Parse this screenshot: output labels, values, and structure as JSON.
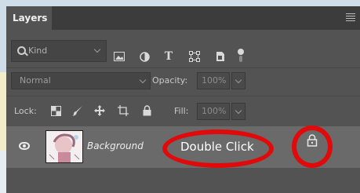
{
  "panel": {
    "title": "Layers"
  },
  "filter": {
    "kind_label": "Kind"
  },
  "blend": {
    "mode": "Normal",
    "opacity_label": "Opacity:",
    "opacity_value": "100%",
    "fill_label": "Fill:",
    "fill_value": "100%"
  },
  "lock": {
    "label": "Lock:"
  },
  "layers": [
    {
      "name": "Background",
      "annotation": "Double Click"
    }
  ],
  "colors": {
    "panel": "#535353",
    "tabbar": "#3c3c3c",
    "selected_row": "#6a6a6a",
    "annotation_red": "#e00a0a"
  },
  "icons": [
    "search-icon",
    "image-filter-icon",
    "adjustment-filter-icon",
    "type-filter-icon",
    "shape-filter-icon",
    "smart-object-filter-icon",
    "filter-toggle-icon",
    "lock-transparent-pixels-icon",
    "lock-image-pixels-icon",
    "lock-position-icon",
    "lock-artboard-icon",
    "lock-all-icon",
    "eye-icon",
    "layer-lock-icon"
  ]
}
